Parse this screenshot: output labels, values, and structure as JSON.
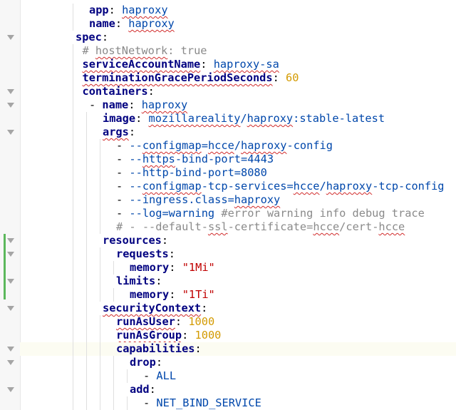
{
  "editor": {
    "lines": [
      {
        "fold": false,
        "segments": [
          {
            "t": "app",
            "c": "key"
          },
          {
            "t": ": ",
            "c": "punc"
          },
          {
            "t": "haproxy",
            "c": "str w"
          }
        ]
      },
      {
        "fold": false,
        "segments": [
          {
            "t": "name",
            "c": "key"
          },
          {
            "t": ": ",
            "c": "punc"
          },
          {
            "t": "haproxy",
            "c": "str w"
          }
        ]
      },
      {
        "fold": true,
        "segments": [
          {
            "t": "spec",
            "c": "key"
          },
          {
            "t": ":",
            "c": "punc"
          }
        ]
      },
      {
        "fold": false,
        "segments": [
          {
            "t": "# ",
            "c": "com"
          },
          {
            "t": "hostNetwork",
            "c": "com w"
          },
          {
            "t": ": true",
            "c": "com"
          }
        ]
      },
      {
        "fold": false,
        "segments": [
          {
            "t": "serviceAccountName",
            "c": "key w"
          },
          {
            "t": ": ",
            "c": "punc"
          },
          {
            "t": "haproxy-sa",
            "c": "str w"
          }
        ]
      },
      {
        "fold": false,
        "segments": [
          {
            "t": "terminationGracePeriodSeconds",
            "c": "key w"
          },
          {
            "t": ": ",
            "c": "punc"
          },
          {
            "t": "60",
            "c": "num"
          }
        ]
      },
      {
        "fold": true,
        "segments": [
          {
            "t": "containers",
            "c": "key"
          },
          {
            "t": ":",
            "c": "punc"
          }
        ]
      },
      {
        "fold": true,
        "segments": [
          {
            "t": "- ",
            "c": "punc"
          },
          {
            "t": "name",
            "c": "key"
          },
          {
            "t": ": ",
            "c": "punc"
          },
          {
            "t": "haproxy",
            "c": "str w"
          }
        ]
      },
      {
        "fold": false,
        "segments": [
          {
            "t": "image",
            "c": "key"
          },
          {
            "t": ": ",
            "c": "punc"
          },
          {
            "t": "mozillareality",
            "c": "str w"
          },
          {
            "t": "/",
            "c": "str"
          },
          {
            "t": "haproxy",
            "c": "str w"
          },
          {
            "t": ":stable-latest",
            "c": "str"
          }
        ]
      },
      {
        "fold": true,
        "segments": [
          {
            "t": "args",
            "c": "key w"
          },
          {
            "t": ":",
            "c": "punc"
          }
        ]
      },
      {
        "fold": false,
        "segments": [
          {
            "t": "- ",
            "c": "punc"
          },
          {
            "t": "--",
            "c": "str"
          },
          {
            "t": "configmap",
            "c": "str w"
          },
          {
            "t": "=",
            "c": "str"
          },
          {
            "t": "hcce",
            "c": "str w"
          },
          {
            "t": "/",
            "c": "str"
          },
          {
            "t": "haproxy",
            "c": "str w"
          },
          {
            "t": "-config",
            "c": "str"
          }
        ]
      },
      {
        "fold": false,
        "segments": [
          {
            "t": "- ",
            "c": "punc"
          },
          {
            "t": "--",
            "c": "str"
          },
          {
            "t": "https",
            "c": "str w"
          },
          {
            "t": "-bind-port=4443",
            "c": "str"
          }
        ]
      },
      {
        "fold": false,
        "segments": [
          {
            "t": "- ",
            "c": "punc"
          },
          {
            "t": "--http-bind-port=8080",
            "c": "str"
          }
        ]
      },
      {
        "fold": false,
        "segments": [
          {
            "t": "- ",
            "c": "punc"
          },
          {
            "t": "--",
            "c": "str"
          },
          {
            "t": "configmap",
            "c": "str w"
          },
          {
            "t": "-tcp-services=",
            "c": "str"
          },
          {
            "t": "hcce",
            "c": "str w"
          },
          {
            "t": "/",
            "c": "str"
          },
          {
            "t": "haproxy",
            "c": "str w"
          },
          {
            "t": "-tcp-config",
            "c": "str"
          }
        ]
      },
      {
        "fold": false,
        "segments": [
          {
            "t": "- ",
            "c": "punc"
          },
          {
            "t": "--ingress.class=",
            "c": "str"
          },
          {
            "t": "haproxy",
            "c": "str w"
          }
        ]
      },
      {
        "fold": false,
        "segments": [
          {
            "t": "- ",
            "c": "punc"
          },
          {
            "t": "--log=warning ",
            "c": "str"
          },
          {
            "t": "#error warning info debug trace",
            "c": "com"
          }
        ]
      },
      {
        "fold": false,
        "segments": [
          {
            "t": "# - --default-",
            "c": "com"
          },
          {
            "t": "ssl",
            "c": "com w"
          },
          {
            "t": "-certificate=",
            "c": "com"
          },
          {
            "t": "hcce",
            "c": "com w"
          },
          {
            "t": "/cert-",
            "c": "com"
          },
          {
            "t": "hcce",
            "c": "com w"
          }
        ]
      },
      {
        "fold": true,
        "segments": [
          {
            "t": "resources",
            "c": "key"
          },
          {
            "t": ":",
            "c": "punc"
          }
        ]
      },
      {
        "fold": true,
        "segments": [
          {
            "t": "requests",
            "c": "key"
          },
          {
            "t": ":",
            "c": "punc"
          }
        ]
      },
      {
        "fold": false,
        "segments": [
          {
            "t": "memory",
            "c": "key"
          },
          {
            "t": ": ",
            "c": "punc"
          },
          {
            "t": "\"1Mi\"",
            "c": "red"
          }
        ]
      },
      {
        "fold": true,
        "segments": [
          {
            "t": "limits",
            "c": "key"
          },
          {
            "t": ":",
            "c": "punc"
          }
        ]
      },
      {
        "fold": false,
        "segments": [
          {
            "t": "memory",
            "c": "key"
          },
          {
            "t": ": ",
            "c": "punc"
          },
          {
            "t": "\"1Ti\"",
            "c": "red"
          }
        ]
      },
      {
        "fold": true,
        "segments": [
          {
            "t": "securityContext",
            "c": "key w"
          },
          {
            "t": ":",
            "c": "punc"
          }
        ]
      },
      {
        "fold": false,
        "segments": [
          {
            "t": "runAsUser",
            "c": "key w"
          },
          {
            "t": ": ",
            "c": "punc"
          },
          {
            "t": "1000",
            "c": "num"
          }
        ]
      },
      {
        "fold": false,
        "segments": [
          {
            "t": "runAsGroup",
            "c": "key w"
          },
          {
            "t": ": ",
            "c": "punc"
          },
          {
            "t": "1000",
            "c": "num"
          }
        ]
      },
      {
        "fold": true,
        "segments": [
          {
            "t": "capabilities",
            "c": "key"
          },
          {
            "t": ":",
            "c": "punc"
          }
        ]
      },
      {
        "fold": true,
        "segments": [
          {
            "t": "drop",
            "c": "key"
          },
          {
            "t": ":",
            "c": "punc"
          }
        ]
      },
      {
        "fold": false,
        "segments": [
          {
            "t": "- ",
            "c": "punc"
          },
          {
            "t": "ALL",
            "c": "str"
          }
        ]
      },
      {
        "fold": true,
        "segments": [
          {
            "t": "add",
            "c": "key"
          },
          {
            "t": ":",
            "c": "punc"
          }
        ]
      },
      {
        "fold": false,
        "segments": [
          {
            "t": "- ",
            "c": "punc"
          },
          {
            "t": "NET_BIND_SERVICE",
            "c": "str"
          }
        ]
      }
    ]
  }
}
